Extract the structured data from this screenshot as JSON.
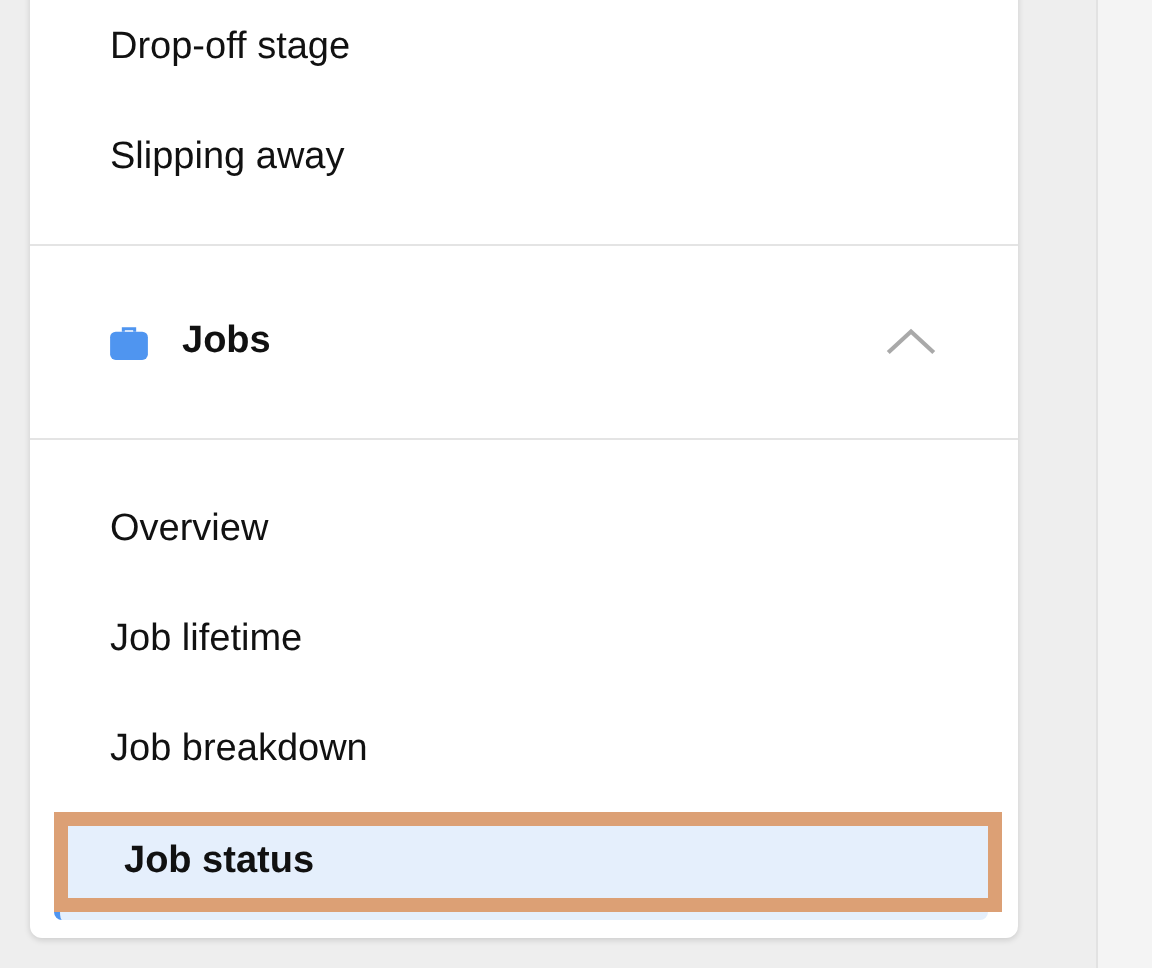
{
  "previous_section": {
    "items": [
      {
        "label": "Drop-off stage",
        "selected": false
      },
      {
        "label": "Slipping away",
        "selected": false
      }
    ]
  },
  "section": {
    "title": "Jobs",
    "expanded": true,
    "items": [
      {
        "label": "Overview",
        "selected": false,
        "highlighted": false
      },
      {
        "label": "Job lifetime",
        "selected": false,
        "highlighted": false
      },
      {
        "label": "Job breakdown",
        "selected": false,
        "highlighted": false
      },
      {
        "label": "Job status",
        "selected": true,
        "highlighted": true
      }
    ]
  }
}
